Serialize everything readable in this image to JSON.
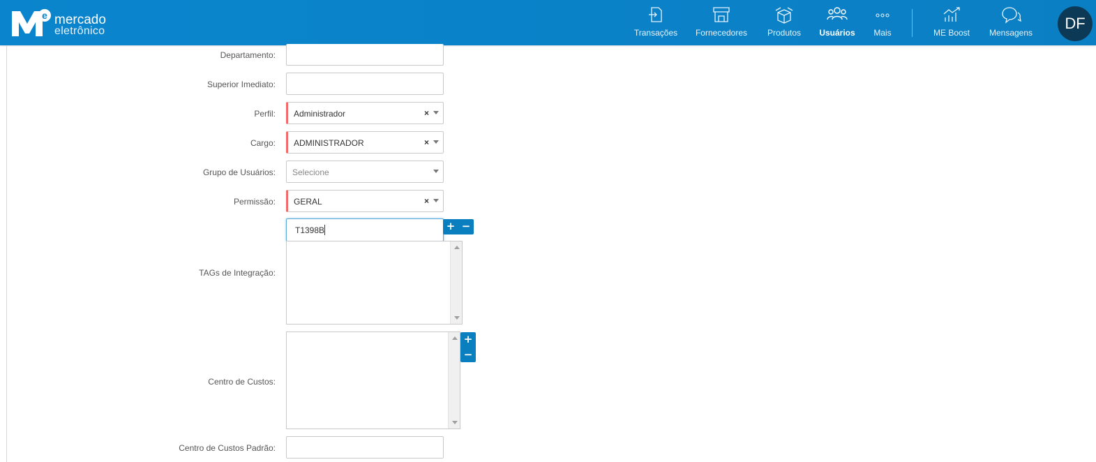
{
  "brand": {
    "line1": "mercado",
    "line2": "eletrônico"
  },
  "nav": {
    "transacoes": "Transações",
    "fornecedores": "Fornecedores",
    "produtos": "Produtos",
    "usuarios": "Usuários",
    "mais": "Mais",
    "me_boost": "ME Boost",
    "mensagens": "Mensagens"
  },
  "user": {
    "initials": "DF"
  },
  "form": {
    "departamento_label": "Departamento:",
    "superior_label": "Superior Imediato:",
    "perfil_label": "Perfil:",
    "perfil_value": "Administrador",
    "cargo_label": "Cargo:",
    "cargo_value": "ADMINISTRADOR",
    "grupo_label": "Grupo de Usuários:",
    "grupo_placeholder": "Selecione",
    "permissao_label": "Permissão:",
    "permissao_value": "GERAL",
    "tags_label": "TAGs de Integração:",
    "tags_input_value": "T1398B",
    "centro_label": "Centro de Custos:",
    "centro_padrao_label": "Centro de Custos Padrão:",
    "clear_glyph": "×",
    "plus_glyph": "+",
    "minus_glyph": "−"
  },
  "colors": {
    "header": "#0a85cd",
    "required": "#f06b6b",
    "button": "#0a7fc0",
    "avatar": "#0c3a56"
  }
}
